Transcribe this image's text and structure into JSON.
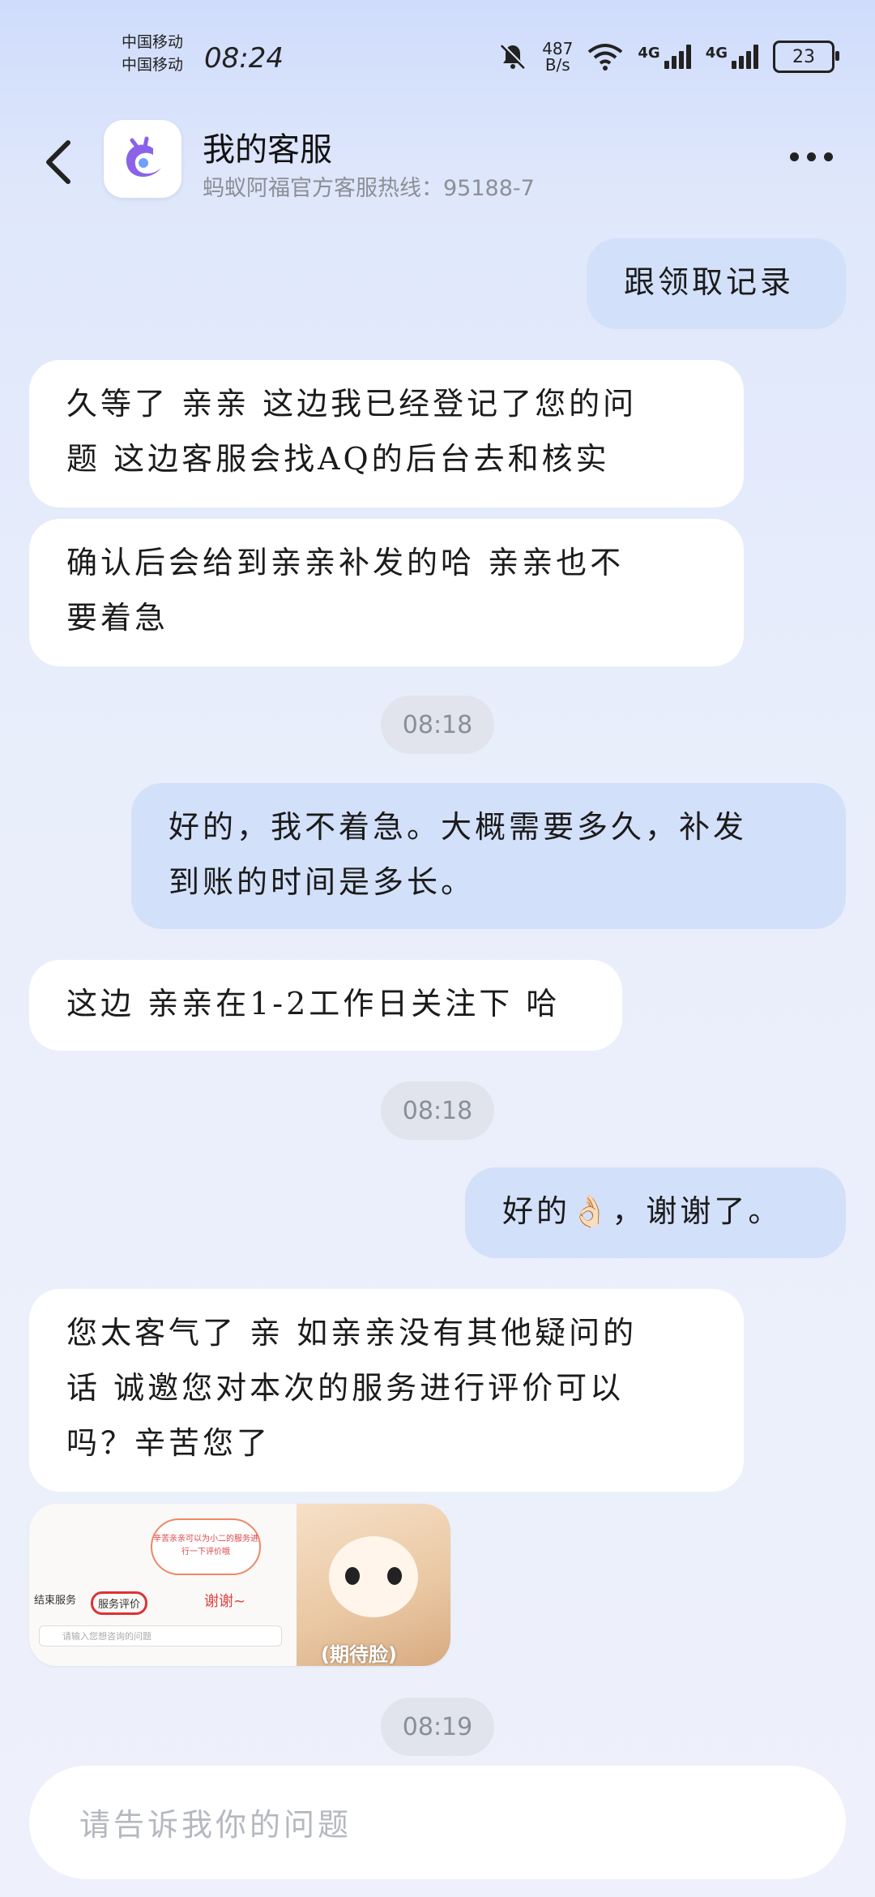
{
  "status": {
    "carrier1": "中国移动",
    "carrier2": "中国移动",
    "time": "08:24",
    "speed_value": "487",
    "speed_unit": "B/s",
    "net1": "4G",
    "net2": "4G",
    "battery": "23"
  },
  "header": {
    "title": "我的客服",
    "subtitle": "蚂蚁阿福官方客服热线：95188-7",
    "brand_color": "#8a63e8"
  },
  "messages": {
    "m1": "跟领取记录",
    "m2_line1": "久等了 亲亲 这边我已经登记了您的问",
    "m2_line2": "题 这边客服会找AQ的后台去和核实",
    "m3_line1": "确认后会给到亲亲补发的哈 亲亲也不",
    "m3_line2": "要着急",
    "t1": "08:18",
    "m4_line1": "好的，我不着急。大概需要多久，补发",
    "m4_line2": "到账的时间是多长。",
    "m5": "这边 亲亲在1-2工作日关注下 哈",
    "t2": "08:18",
    "m6_a": "好的",
    "m6_emoji": "👌🏻",
    "m6_b": "，谢谢了。",
    "m7_line1": "您太客气了 亲 如亲亲没有其他疑问的",
    "m7_line2": "话 诚邀您对本次的服务进行评价可以",
    "m7_line3": "吗？辛苦您了",
    "t3": "08:19"
  },
  "image_message": {
    "speech": "辛苦亲亲可以为小二的服务进行一下评价哦",
    "end_service": "结束服务",
    "rate_service": "服务评价",
    "thanks": "谢谢~",
    "input_hint": "请输入您想咨询的问题",
    "caption": "(期待脸)"
  },
  "input": {
    "placeholder": "请告诉我你的问题"
  }
}
